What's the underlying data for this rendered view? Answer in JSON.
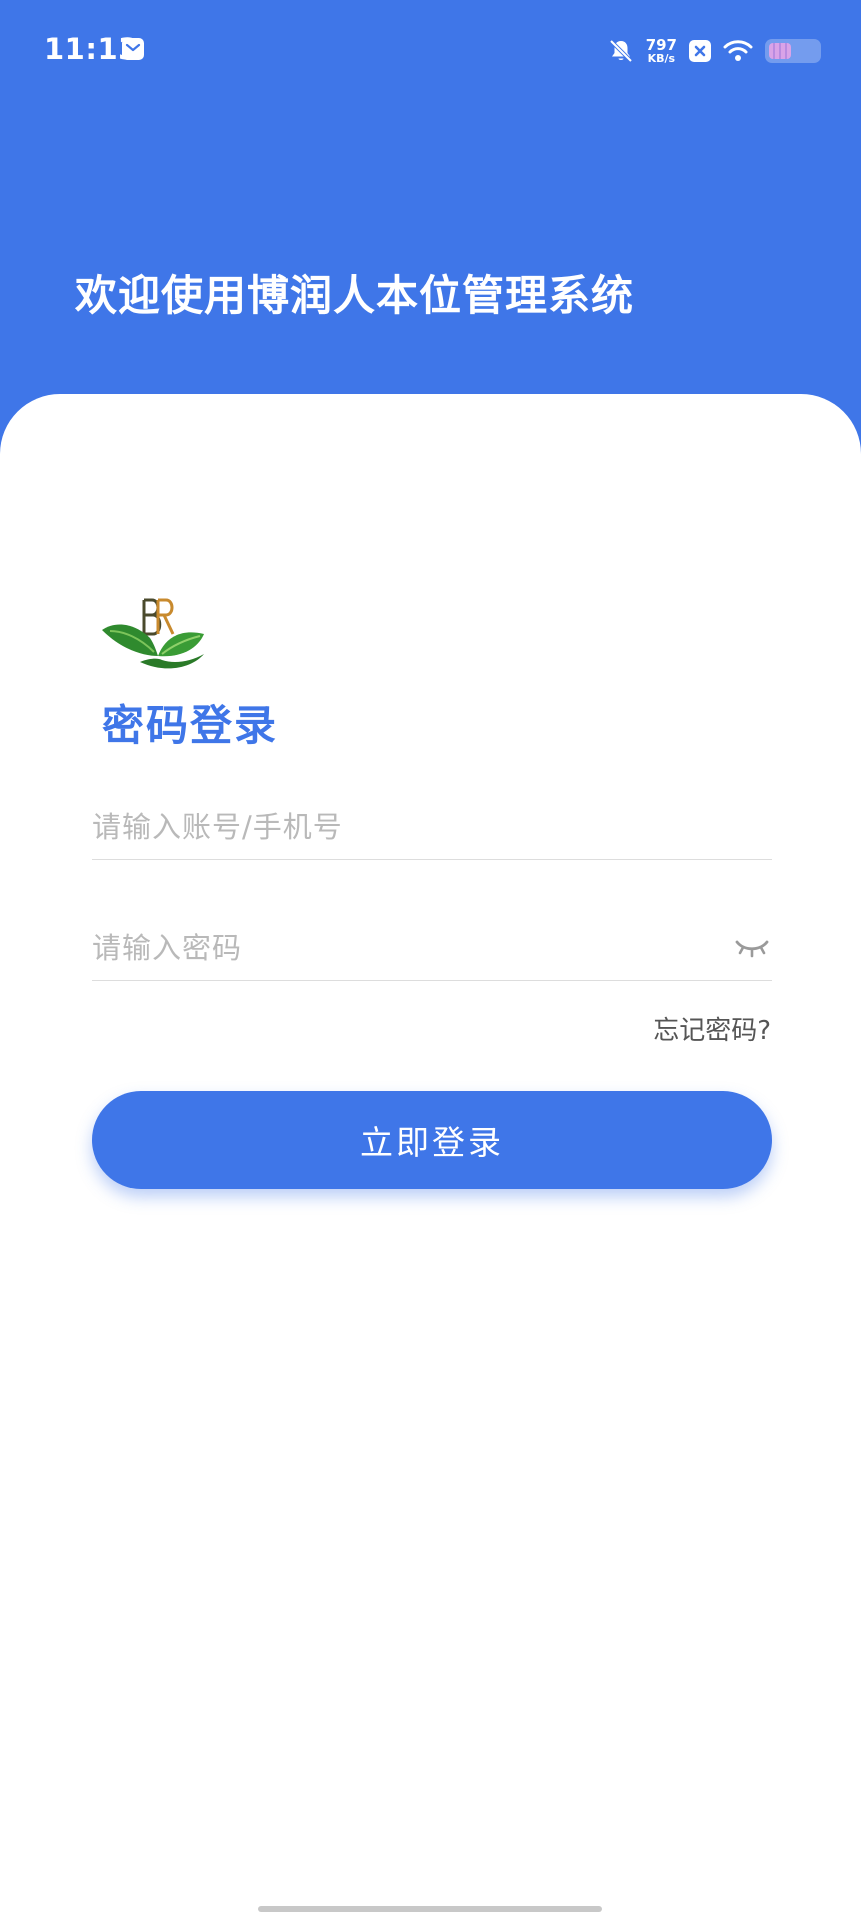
{
  "status_bar": {
    "time": "11:13",
    "net_speed_value": "797",
    "net_speed_unit": "KB/s",
    "battery_level": 0.45,
    "icons": [
      "mail-icon",
      "bell-off-icon",
      "close-box-icon",
      "wifi-icon",
      "battery-icon"
    ]
  },
  "header": {
    "title": "欢迎使用博润人本位管理系统"
  },
  "login": {
    "heading": "密码登录",
    "account_placeholder": "请输入账号/手机号",
    "password_placeholder": "请输入密码",
    "forgot_password": "忘记密码?",
    "submit_label": "立即登录"
  },
  "colors": {
    "primary": "#3f76e8",
    "background": "#ffffff",
    "placeholder": "#b9b9b9",
    "divider": "#dddddd"
  }
}
